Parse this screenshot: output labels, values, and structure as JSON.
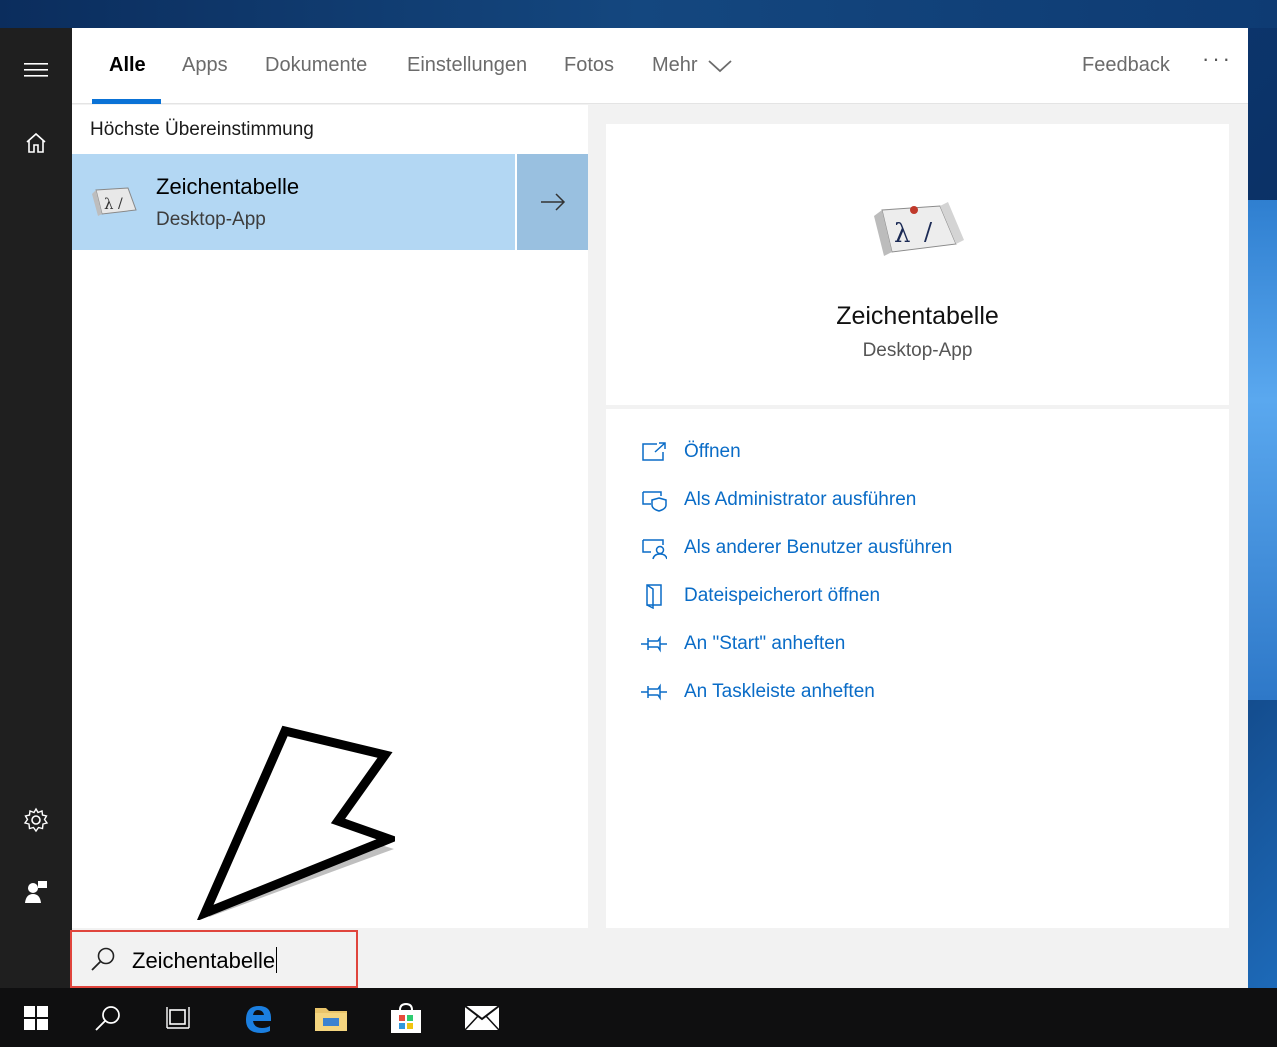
{
  "tabs": {
    "all": "Alle",
    "apps": "Apps",
    "documents": "Dokumente",
    "settings": "Einstellungen",
    "photos": "Fotos",
    "more": "Mehr",
    "feedback": "Feedback",
    "ellipsis": "···"
  },
  "results": {
    "section_title": "Höchste Übereinstimmung",
    "best_match_name": "Zeichentabelle",
    "best_match_type": "Desktop-App"
  },
  "detail": {
    "name": "Zeichentabelle",
    "type": "Desktop-App",
    "actions": [
      {
        "label": "Öffnen",
        "icon": "open-icon"
      },
      {
        "label": "Als Administrator ausführen",
        "icon": "shield-icon"
      },
      {
        "label": "Als anderer Benutzer ausführen",
        "icon": "user-icon"
      },
      {
        "label": "Dateispeicherort öffnen",
        "icon": "folder-location-icon"
      },
      {
        "label": "An \"Start\" anheften",
        "icon": "pin-icon"
      },
      {
        "label": "An Taskleiste anheften",
        "icon": "pin-icon"
      }
    ]
  },
  "search": {
    "query": "Zeichentabelle"
  },
  "colors": {
    "accent": "#0a72d6",
    "link": "#0a6cc7",
    "selection": "#b3d7f3",
    "highlight_border": "#e0453d"
  }
}
